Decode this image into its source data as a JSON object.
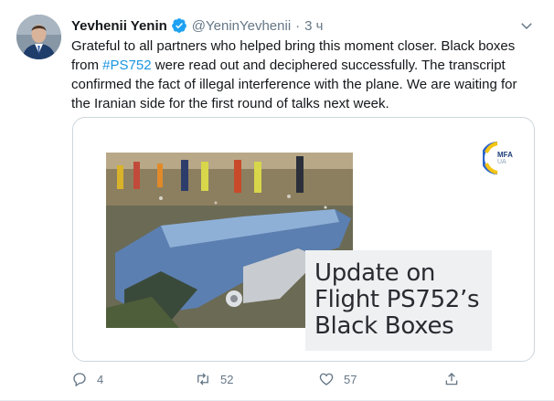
{
  "tweet": {
    "author_name": "Yevhenii Yenin",
    "handle": "@YeninYevhenii",
    "separator": "·",
    "time": "3 ч",
    "text_before": "Grateful to all partners who helped bring this moment closer. Black boxes from ",
    "hashtag": "#PS752",
    "text_after": " were read out and deciphered successfully. The transcript confirmed the fact of illegal interference with the plane. We are waiting for the Iranian side for the first round of talks next week."
  },
  "card": {
    "caption_line1": "Update on",
    "caption_line2": "Flight PS752’s",
    "caption_line3": "Black Boxes",
    "logo_text": "MFA",
    "logo_subtext": "UA"
  },
  "actions": {
    "reply_count": "4",
    "retweet_count": "52",
    "like_count": "57"
  },
  "colors": {
    "link": "#1b95e0",
    "secondary_text": "#657786",
    "verified": "#1da1f2"
  },
  "icons": [
    "verified-badge-icon",
    "chevron-down-icon",
    "reply-icon",
    "retweet-icon",
    "like-icon",
    "share-icon"
  ]
}
